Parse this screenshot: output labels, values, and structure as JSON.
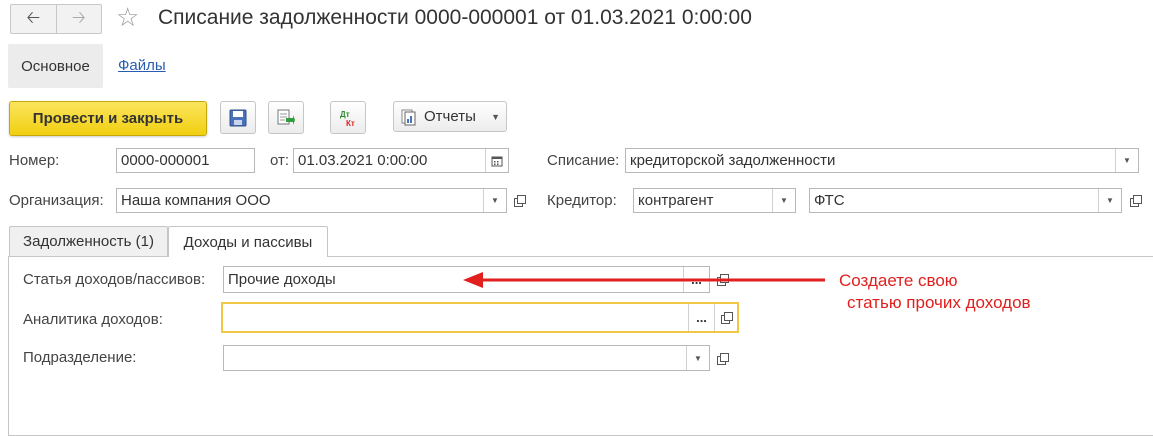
{
  "header": {
    "back_icon": "arrow-left-icon",
    "forward_icon": "arrow-right-icon",
    "favorite_icon": "star-icon",
    "title": "Списание задолженности 0000-000001 от 01.03.2021 0:00:00"
  },
  "section_tabs": {
    "main": "Основное",
    "files": "Файлы"
  },
  "toolbar": {
    "post_close": "Провести и закрыть",
    "save_icon": "save-icon",
    "post_icon": "post-document-icon",
    "dtkt_icon": "dt-kt-icon",
    "dt_text": "Дт",
    "kt_text": "Кт",
    "reports": "Отчеты"
  },
  "form": {
    "number_label": "Номер:",
    "number_value": "0000-000001",
    "date_label": "от:",
    "date_value": "01.03.2021  0:00:00",
    "writeoff_label": "Списание:",
    "writeoff_value": "кредиторской задолженности",
    "org_label": "Организация:",
    "org_value": "Наша компания ООО",
    "creditor_label": "Кредитор:",
    "creditor_type": "контрагент",
    "creditor_value": "ФТС"
  },
  "tabs": {
    "debt": "Задолженность (1)",
    "income": "Доходы и пассивы"
  },
  "income_tab": {
    "article_label": "Статья доходов/пассивов:",
    "article_value": "Прочие доходы",
    "analytics_label": "Аналитика доходов:",
    "analytics_value": "",
    "division_label": "Подразделение:",
    "division_value": ""
  },
  "annotation": {
    "line1": "Создаете свою",
    "line2": "статью прочих доходов",
    "color": "#e0201e"
  },
  "colors": {
    "post_button": "#f6da2e",
    "focus_border": "#f2c744"
  }
}
